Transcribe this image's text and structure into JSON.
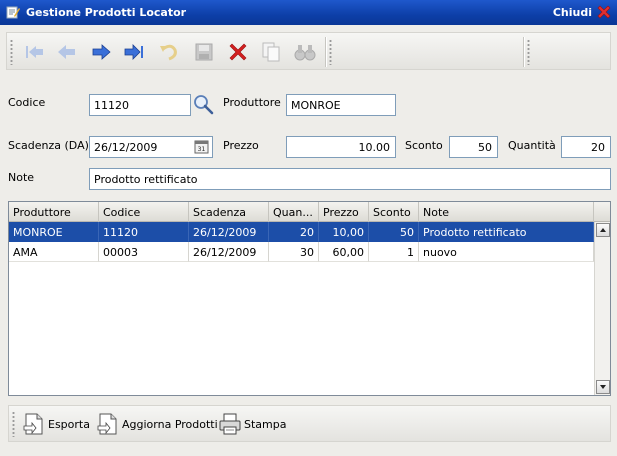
{
  "window": {
    "title": "Gestione Prodotti Locator",
    "close_label": "Chiudi"
  },
  "toolbar": {
    "buttons": [
      {
        "name": "first-record-icon"
      },
      {
        "name": "previous-record-icon"
      },
      {
        "name": "next-record-icon"
      },
      {
        "name": "last-record-icon"
      },
      {
        "name": "undo-icon"
      },
      {
        "name": "save-icon"
      },
      {
        "name": "delete-icon"
      },
      {
        "name": "copy-icon"
      },
      {
        "name": "search-binoculars-icon"
      }
    ]
  },
  "form": {
    "codice_label": "Codice",
    "codice_value": "11120",
    "produttore_label": "Produttore",
    "produttore_value": "MONROE",
    "scadenza_label": "Scadenza (DA)",
    "scadenza_value": "26/12/2009",
    "prezzo_label": "Prezzo",
    "prezzo_value": "10.00",
    "sconto_label": "Sconto",
    "sconto_value": "50",
    "quantita_label": "Quantità",
    "quantita_value": "20",
    "note_label": "Note",
    "note_value": "Prodotto rettificato"
  },
  "grid": {
    "columns": [
      "Produttore",
      "Codice",
      "Scadenza",
      "Quan...",
      "Prezzo",
      "Sconto",
      "Note"
    ],
    "rows": [
      [
        "MONROE",
        "11120",
        "26/12/2009",
        "20",
        "10,00",
        "50",
        "Prodotto rettificato"
      ],
      [
        "AMA",
        "00003",
        "26/12/2009",
        "30",
        "60,00",
        "1",
        "nuovo"
      ]
    ]
  },
  "bottom": {
    "esporta": "Esporta",
    "aggiorna": "Aggiorna Prodotti",
    "stampa": "Stampa"
  },
  "colors": {
    "title_bar": "#0d3fa8",
    "selection": "#1c4ea8",
    "delete_red": "#d42020",
    "nav_blue": "#3a6fd8"
  }
}
